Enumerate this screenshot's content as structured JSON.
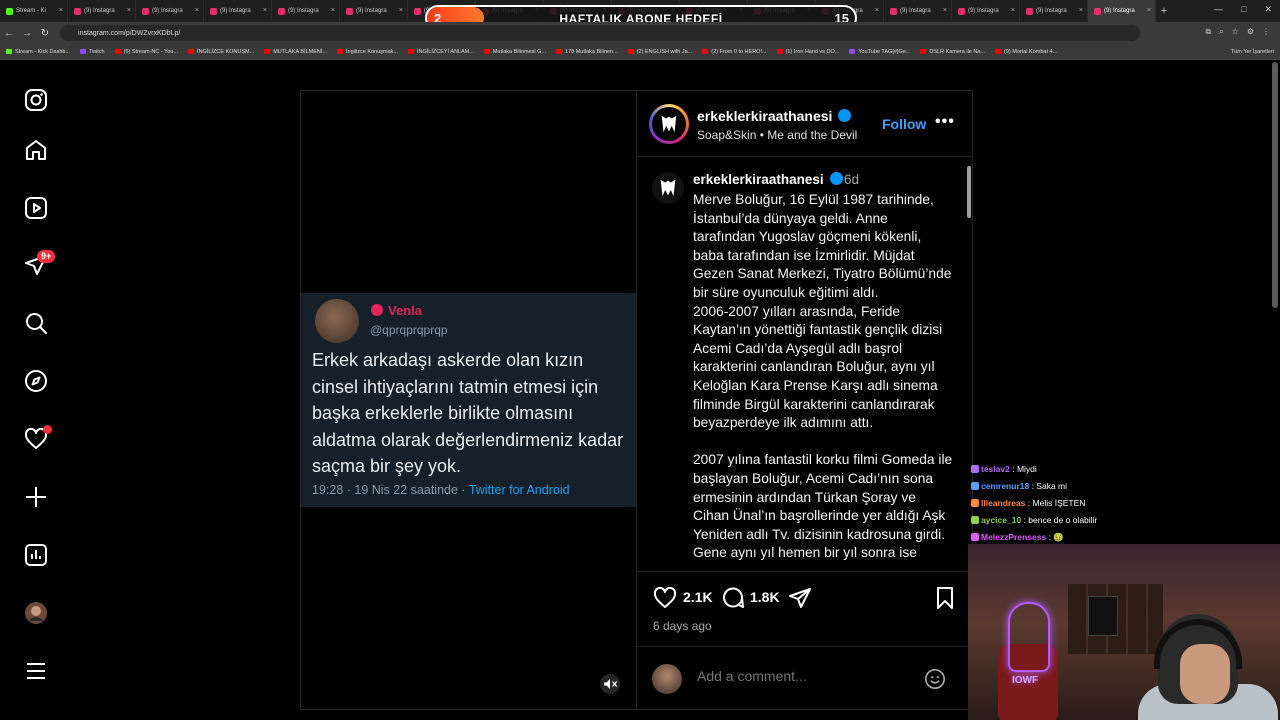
{
  "browser": {
    "tabs": [
      {
        "title": "Stream - Ki",
        "icon": "kick"
      },
      {
        "title": "(9) Instagra",
        "icon": "instagram"
      },
      {
        "title": "(9) Instagra",
        "icon": "instagram"
      },
      {
        "title": "(9) Instagra",
        "icon": "instagram"
      },
      {
        "title": "(9) Instagra",
        "icon": "instagram"
      },
      {
        "title": "(9) Instagra",
        "icon": "instagram"
      },
      {
        "title": "(9) Instagra",
        "icon": "instagram"
      },
      {
        "title": "(9) Instagra",
        "icon": "instagram"
      },
      {
        "title": "(9) Instagra",
        "icon": "instagram"
      },
      {
        "title": "(9) Instagra",
        "icon": "instagram"
      },
      {
        "title": "(9) Instagra",
        "icon": "instagram"
      },
      {
        "title": "(9) Instagra",
        "icon": "instagram"
      },
      {
        "title": "(9) Instagra",
        "icon": "instagram"
      },
      {
        "title": "(9) Instagra",
        "icon": "instagram"
      },
      {
        "title": "(9) Instagra",
        "icon": "instagram"
      },
      {
        "title": "(9) Instagra",
        "icon": "instagram"
      },
      {
        "title": "(9) Instagra",
        "icon": "instagram",
        "active": true
      }
    ],
    "url": "instagram.com/p/DWZvrxKDbLp/",
    "bookmarks": [
      {
        "label": "Stream - Kick Dashb...",
        "icon": "kick"
      },
      {
        "label": "Twitch",
        "icon": "twitch"
      },
      {
        "label": "(6) Stream-NC - You...",
        "icon": "youtube"
      },
      {
        "label": "İNGİLİZCE KONUŞM...",
        "icon": "youtube"
      },
      {
        "label": "MUTLAKA BİLMENİ...",
        "icon": "youtube"
      },
      {
        "label": "İngilizce Konuşmak...",
        "icon": "youtube"
      },
      {
        "label": "İNGİLİZCEYİ ANLAM...",
        "icon": "youtube"
      },
      {
        "label": "Mutlaka Bilinmesi G...",
        "icon": "youtube"
      },
      {
        "label": "178 Mutlaka Bilinen...",
        "icon": "youtube"
      },
      {
        "label": "(2) ENGLISH with Ja...",
        "icon": "youtube"
      },
      {
        "label": "(2) From 0 to HERO!...",
        "icon": "youtube"
      },
      {
        "label": "(1) Iron Hand vs DO...",
        "icon": "youtube"
      },
      {
        "label": "YouTube TAG[#]Ge...",
        "icon": "twitch"
      },
      {
        "label": "DSLR Kamera ile Na...",
        "icon": "youtube"
      },
      {
        "label": "(9) Mortal Kombat 4...",
        "icon": "youtube"
      }
    ],
    "bookmarks_right": "Tüm Yer İşaretleri"
  },
  "goal": {
    "current": "2",
    "title": "HAFTALIK ABONE HEDEFİ",
    "target": "15",
    "progress_fraction": 0.133,
    "color_start": "#ff3c1e",
    "color_end": "#ff7a2e"
  },
  "sidebar": {
    "icons": [
      "instagram-logo-icon",
      "home-icon",
      "reels-icon",
      "messages-icon",
      "search-icon",
      "explore-icon",
      "notifications-icon",
      "create-icon",
      "dashboard-icon",
      "profile-icon",
      "menu-icon"
    ],
    "messages_badge": "9+"
  },
  "tweet": {
    "name": "Venla",
    "handle": "@qprqprqprqp",
    "text": "Erkek arkadaşı askerde olan kızın cinsel ihtiyaçlarını tatmin etmesi için başka erkeklerle birlikte olmasını aldatma olarak değerlendirmeniz kadar saçma bir şey yok.",
    "meta": "19:28 · 19 Nis 22 saatinde · ",
    "source": "Twitter for Android"
  },
  "post": {
    "username": "erkeklerkiraathanesi",
    "audio_artist": "Soap&Skin",
    "audio_sep": "•",
    "audio_track": "Me and the Devil",
    "follow_label": "Follow",
    "caption_time": "6d",
    "caption_p1": "Merve Boluğur, 16 Eylül 1987 tarihinde, İstanbul’da dünyaya geldi. Anne tarafından Yugoslav göçmeni kökenli, baba tarafından ise İzmirlidir. Müjdat Gezen Sanat Merkezi, Tiyatro Bölümü’nde bir süre oyunculuk eğitimi aldı.",
    "caption_p2": "2006-2007 yılları arasında, Feride Kaytan’ın yönettiği fantastik gençlik dizisi Acemi Cadı’da Ayşegül adlı başrol karakterini canlandıran Boluğur, aynı yıl Keloğlan Kara Prense Karşı adlı sinema filminde Birgül karakterini canlandırarak beyazperdeye ilk adımını attı.",
    "caption_p3": "2007 yılına fantastil korku filmi Gomeda ile başlayan Boluğur, Acemi Cadı’nın sona ermesinin ardından Türkan Şoray ve Cihan Ünal’ın başrollerinde yer aldığı Aşk Yeniden adlı Tv. dizisinin kadrosuna girdi. Gene aynı yıl hemen bir yıl sonra ise",
    "likes": "2.1K",
    "comments": "1.8K",
    "posted": "6 days ago",
    "comment_placeholder": "Add a comment..."
  },
  "chat": [
    {
      "user": "teslav2",
      "message": "Miydi",
      "color": "#b36bff"
    },
    {
      "user": "cemrenur18",
      "message": "Saka mi",
      "color": "#5aa0ff"
    },
    {
      "user": "llleandreas",
      "message": "Melis İŞETEN",
      "color": "#ff8a3c"
    },
    {
      "user": "aycice_10",
      "message": "bence de o olabilir",
      "color": "#8bd34a"
    },
    {
      "user": "MelezzPrensess",
      "message": "🤢",
      "color": "#e05aff"
    }
  ],
  "webcam": {
    "neon_text": "IOWF"
  }
}
